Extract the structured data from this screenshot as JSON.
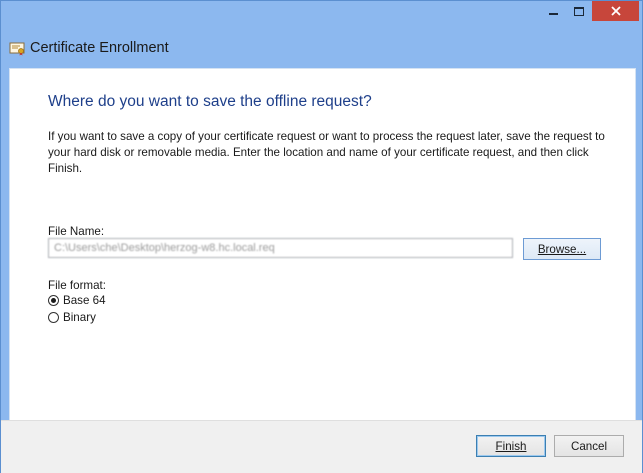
{
  "window": {
    "title": "Certificate Enrollment",
    "controls": {
      "minimize": "minimize",
      "maximize": "maximize",
      "close": "close"
    }
  },
  "page": {
    "heading": "Where do you want to save the offline request?",
    "description": "If you want to save a copy of your certificate request or want to process the request later, save the request to your hard disk or removable media. Enter the location and name of your certificate request, and then click Finish."
  },
  "file_name": {
    "label": "File Name:",
    "value": "C:\\Users\\che\\Desktop\\herzog-w8.hc.local.req",
    "browse_label": "Browse..."
  },
  "file_format": {
    "label": "File format:",
    "options": [
      {
        "label": "Base 64",
        "selected": true
      },
      {
        "label": "Binary",
        "selected": false
      }
    ]
  },
  "footer": {
    "finish_label": "Finish",
    "cancel_label": "Cancel"
  },
  "icons": {
    "app": "certificate-icon",
    "close": "close-icon"
  },
  "colors": {
    "window_frame": "#8cb8ef",
    "heading": "#1e3f8a",
    "close_button": "#c7463b"
  }
}
